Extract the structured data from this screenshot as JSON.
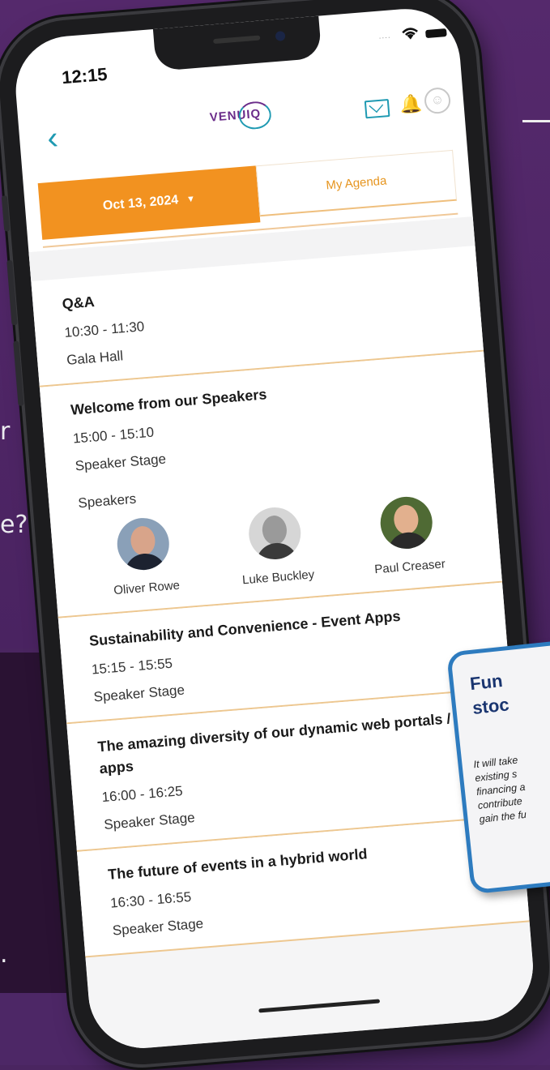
{
  "background_fragments": {
    "frag1": "r",
    "frag2": "e?",
    "frag3": "."
  },
  "status_bar": {
    "time": "12:15"
  },
  "app_bar": {
    "logo": "VENUIQ",
    "back_icon": "chevron-left-icon",
    "icons": [
      "mail-icon",
      "bell-icon",
      "user-icon"
    ]
  },
  "tabs": {
    "date_label": "Oct 13, 2024",
    "agenda_label": "My Agenda"
  },
  "sessions": [
    {
      "title": "Q&A",
      "time": "10:30 - 11:30",
      "room": "Gala Hall"
    },
    {
      "title": "Welcome from our Speakers",
      "time": "15:00 - 15:10",
      "room": "Speaker Stage",
      "speakers_label": "Speakers",
      "speakers": [
        {
          "name": "Oliver Rowe"
        },
        {
          "name": "Luke Buckley"
        },
        {
          "name": "Paul Creaser"
        }
      ]
    },
    {
      "title": "Sustainability and Convenience - Event Apps",
      "time": "15:15 - 15:55",
      "room": "Speaker Stage"
    },
    {
      "title": "The amazing diversity of our dynamic web portals / apps",
      "time": "16:00 - 16:25",
      "room": "Speaker Stage"
    },
    {
      "title": "The future of events in a hybrid world",
      "time": "16:30 - 16:55",
      "room": "Speaker Stage"
    }
  ],
  "overlay_card": {
    "title_line1": "Fun",
    "title_line2": "stoc",
    "body": [
      "It will take",
      "existing s",
      "financing a",
      "contribute",
      "gain the fu"
    ]
  },
  "colors": {
    "accent_orange": "#f29220",
    "accent_teal": "#1f9ab2",
    "brand_purple": "#6b2c8a",
    "card_border": "#2d7bbf"
  }
}
